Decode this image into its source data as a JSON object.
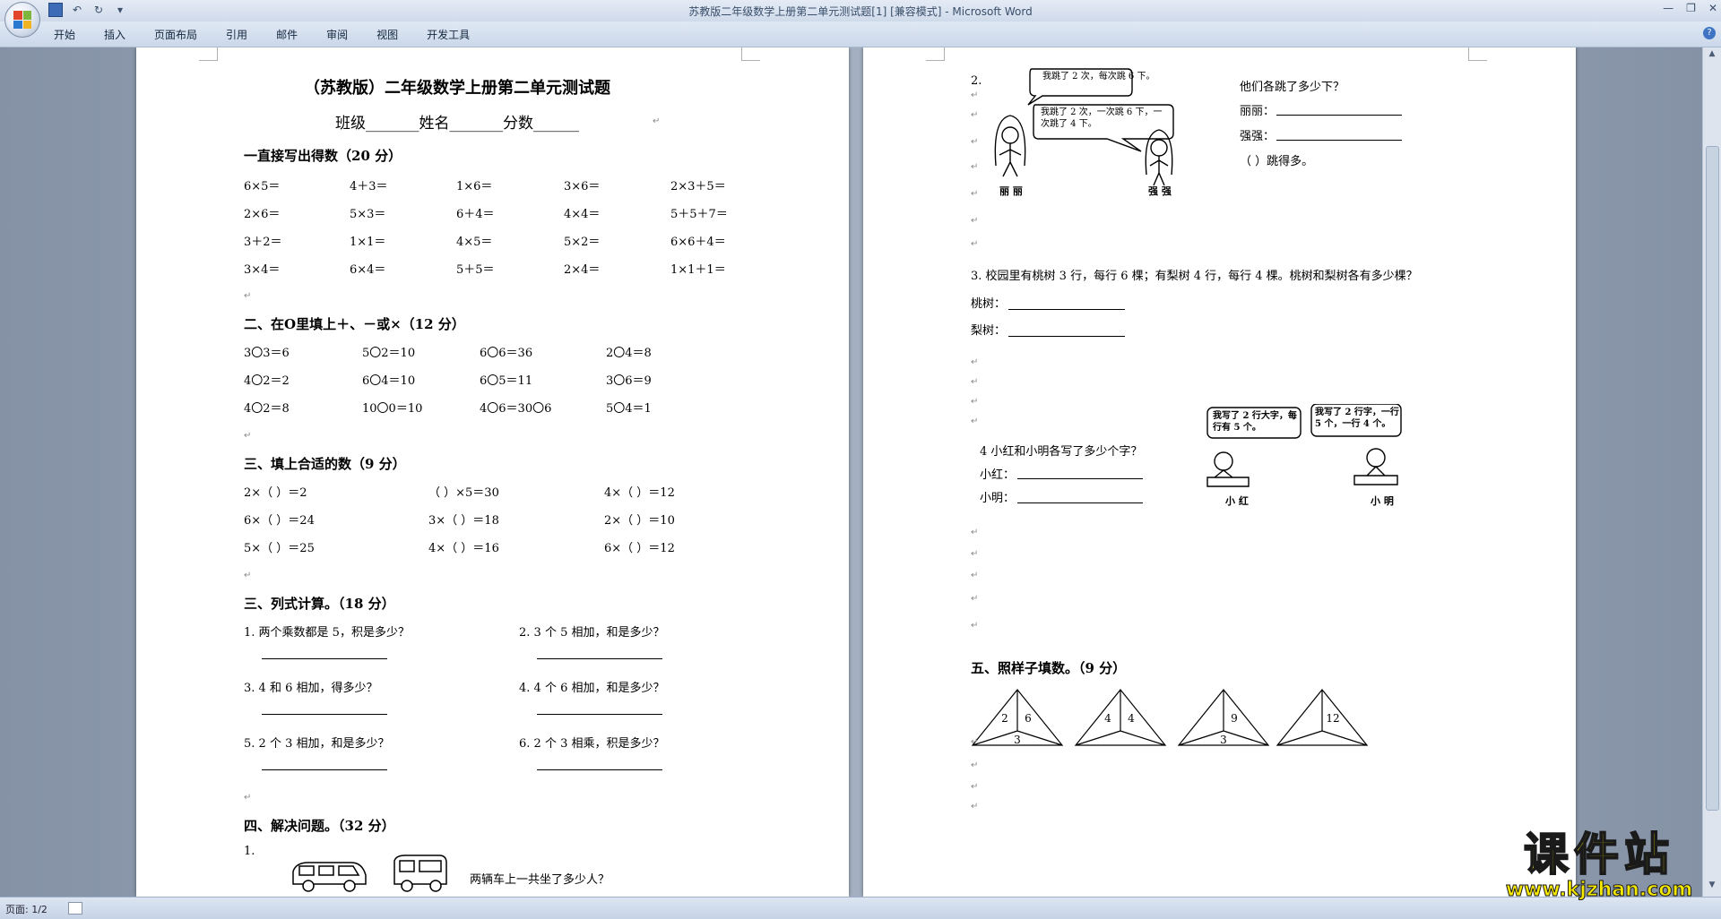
{
  "window": {
    "title": "苏教版二年级数学上册第二单元测试题[1] [兼容模式] - Microsoft Word"
  },
  "qat": {
    "save": "save-icon",
    "undo": "↶",
    "redo": "↻",
    "more": "▾"
  },
  "ribbon": {
    "tabs": [
      "开始",
      "插入",
      "页面布局",
      "引用",
      "邮件",
      "审阅",
      "视图",
      "开发工具"
    ]
  },
  "status": {
    "page": "页面: 1/2"
  },
  "doc": {
    "title": "（苏教版）二年级数学上册第二单元测试题",
    "header_line": "班级_______姓名_______分数______",
    "sec1": {
      "title": "一直接写出得数（20 分）",
      "rows": [
        [
          "6×5＝",
          "4＋3＝",
          "1×6＝",
          "3×6＝",
          "2×3＋5＝"
        ],
        [
          "2×6＝",
          "5×3＝",
          "6＋4＝",
          "4×4＝",
          "5＋5＋7＝"
        ],
        [
          "3＋2＝",
          "1×1＝",
          "4×5＝",
          "5×2＝",
          "6×6＋4＝"
        ],
        [
          "3×4＝",
          "6×4＝",
          "5＋5＝",
          "2×4＝",
          "1×1＋1＝"
        ]
      ]
    },
    "sec2": {
      "title": "二、在O里填上＋、－或×（12 分）",
      "rows": [
        [
          "3〇3＝6",
          "5〇2＝10",
          "6〇6＝36",
          "2〇4＝8"
        ],
        [
          "4〇2＝2",
          "6〇4＝10",
          "6〇5＝11",
          "3〇6＝9"
        ],
        [
          "4〇2＝8",
          "10〇0＝10",
          "4〇6＝30〇6",
          "5〇4＝1"
        ]
      ]
    },
    "sec3": {
      "title": "三、填上合适的数（9 分）",
      "rows": [
        [
          "2×（  ）＝2",
          "（  ）×5＝30",
          "4×（  ）＝12"
        ],
        [
          "6×（  ）＝24",
          "3×（  ）＝18",
          "2×（  ）＝10"
        ],
        [
          "5×（  ）＝25",
          "4×（  ）＝16",
          "6×（  ）＝12"
        ]
      ]
    },
    "sec4": {
      "title": "三、列式计算。（18 分）",
      "items": [
        "1. 两个乘数都是 5，积是多少？",
        "2. 3 个 5 相加，和是多少？",
        "3. 4 和 6 相加，得多少？",
        "4. 4 个 6 相加，和是多少？",
        "5. 2 个 3 相加，和是多少？",
        "6. 2 个 3 相乘，积是多少？"
      ]
    },
    "sec5": {
      "title": "四、解决问题。（32 分）",
      "q1_num": "1.",
      "q1_text": "两辆车上一共坐了多少人？",
      "q2_num": "2.",
      "q2_bubble1": "我跳了 2 次，每次跳 6 下。",
      "q2_bubble2": "我跳了 2 次，一次跳 6 下，一次跳了 4 下。",
      "q2_name1": "丽 丽",
      "q2_name2": "强 强",
      "q2_question": "他们各跳了多少下？",
      "q2_lili": "丽丽：",
      "q2_qiangqiang": "强强：",
      "q2_more": "（        ）跳得多。",
      "q3_text": "3. 校园里有桃树 3 行，每行 6 棵；有梨树 4 行，每行 4 棵。桃树和梨树各有多少棵？",
      "q3_peach": "桃树：",
      "q3_pear": "梨树：",
      "q4_bubble1": "我写了 2 行大字，每行有 5 个。",
      "q4_bubble2": "我写了 2 行字，一行 5 个，一行 4 个。",
      "q4_name1": "小 红",
      "q4_name2": "小 明",
      "q4_question": "4 小红和小明各写了多少个字？",
      "q4_xh": "小红：",
      "q4_xm": "小明："
    },
    "sec6": {
      "title": "五、照样子填数。（9 分）",
      "triangles": [
        {
          "left": "2",
          "right": "6",
          "bottom": "3"
        },
        {
          "left": "4",
          "right": "4",
          "bottom": ""
        },
        {
          "left": "",
          "right": "9",
          "bottom": "3"
        },
        {
          "left": "",
          "right": "12",
          "bottom": ""
        }
      ]
    }
  },
  "watermark": {
    "brand": "课件站",
    "url": "www.kjzhan.com"
  }
}
